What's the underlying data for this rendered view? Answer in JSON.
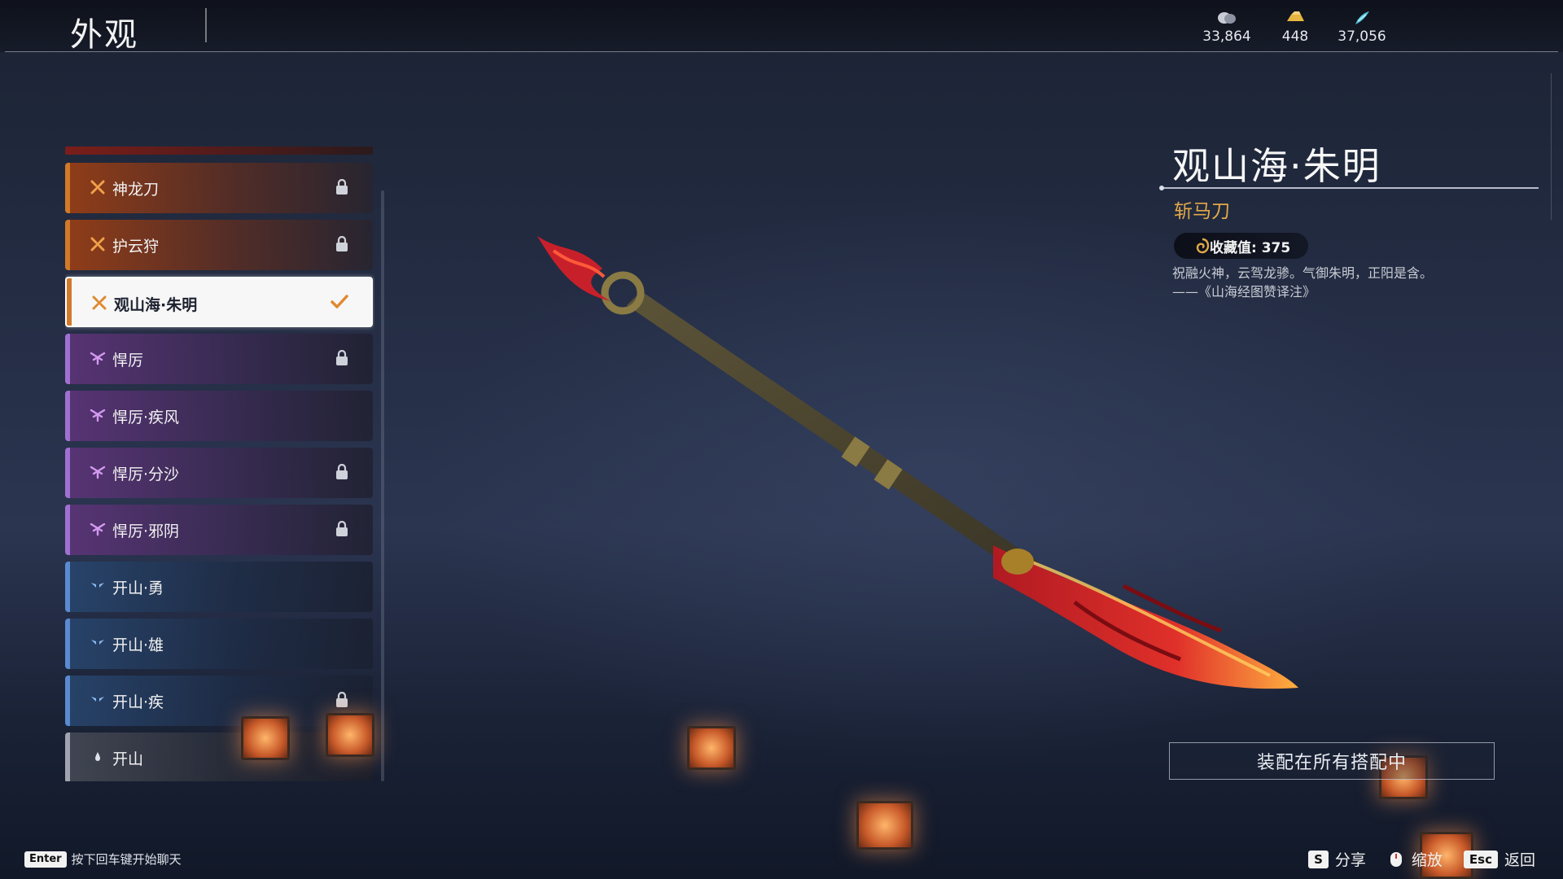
{
  "header": {
    "title": "外观",
    "currencies": [
      {
        "icon": "coin-icon",
        "value": "33,864"
      },
      {
        "icon": "gold-ingot-icon",
        "value": "448"
      },
      {
        "icon": "jade-feather-icon",
        "value": "37,056"
      }
    ]
  },
  "skin_list": {
    "items": [
      {
        "label": "神龙刀",
        "rarity": "orange",
        "icon": "rarity-orange-icon",
        "locked": true,
        "selected": false
      },
      {
        "label": "护云狩",
        "rarity": "orange",
        "icon": "rarity-orange-icon",
        "locked": true,
        "selected": false
      },
      {
        "label": "观山海·朱明",
        "rarity": "orange",
        "icon": "rarity-orange-icon",
        "locked": false,
        "selected": true
      },
      {
        "label": "悍厉",
        "rarity": "purple",
        "icon": "rarity-purple-icon",
        "locked": true,
        "selected": false
      },
      {
        "label": "悍厉·疾风",
        "rarity": "purple",
        "icon": "rarity-purple-icon",
        "locked": false,
        "selected": false
      },
      {
        "label": "悍厉·分沙",
        "rarity": "purple",
        "icon": "rarity-purple-icon",
        "locked": true,
        "selected": false
      },
      {
        "label": "悍厉·邪阴",
        "rarity": "purple",
        "icon": "rarity-purple-icon",
        "locked": true,
        "selected": false
      },
      {
        "label": "开山·勇",
        "rarity": "blue",
        "icon": "rarity-blue-icon",
        "locked": false,
        "selected": false
      },
      {
        "label": "开山·雄",
        "rarity": "blue",
        "icon": "rarity-blue-icon",
        "locked": false,
        "selected": false
      },
      {
        "label": "开山·疾",
        "rarity": "blue",
        "icon": "rarity-blue-icon",
        "locked": true,
        "selected": false
      },
      {
        "label": "开山",
        "rarity": "grey",
        "icon": "rarity-grey-icon",
        "locked": false,
        "selected": false
      }
    ]
  },
  "detail": {
    "name": "观山海·朱明",
    "type": "斩马刀",
    "collect_value": "收藏值: 375",
    "description_line1": "祝融火神，云驾龙骖。气御朱明，正阳是含。",
    "description_line2": "——《山海经图赞译注》",
    "equip_all_label": "装配在所有搭配中"
  },
  "footer": {
    "chat_key": "Enter",
    "chat_hint": "按下回车键开始聊天",
    "share_key": "S",
    "share_label": "分享",
    "zoom_label": "缩放",
    "back_key": "Esc",
    "back_label": "返回"
  },
  "colors": {
    "orange": "#c8702a",
    "purple": "#a070d0",
    "blue": "#5a8ad0",
    "grey": "#a0a4b0",
    "accent_gold": "#e1a94a"
  }
}
